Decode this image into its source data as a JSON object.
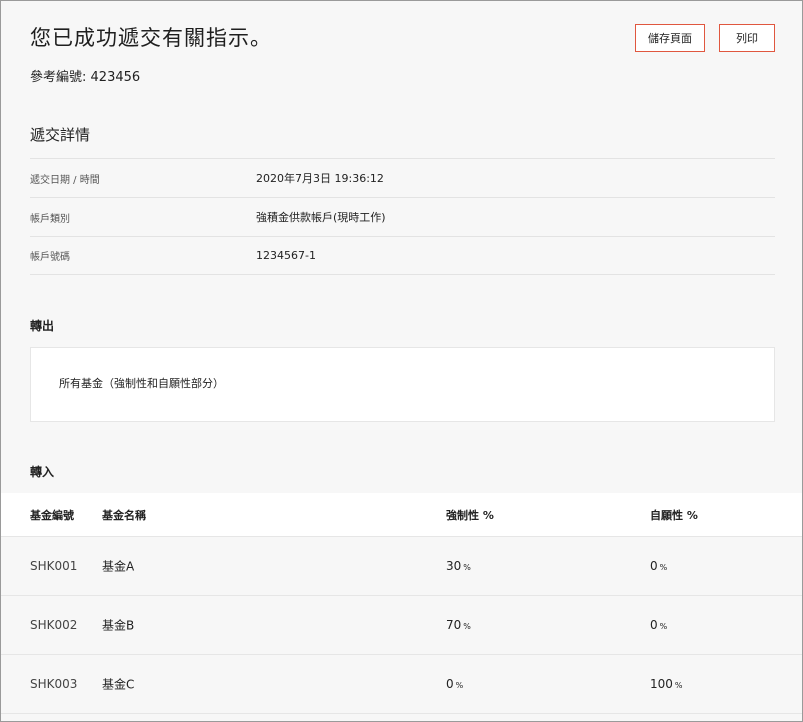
{
  "header": {
    "title": "您已成功遞交有關指示。",
    "reference_label": "參考編號:",
    "reference_number": "423456",
    "save_label": "儲存頁面",
    "print_label": "列印"
  },
  "details": {
    "title": "遞交詳情",
    "rows": [
      {
        "label": "遞交日期 / 時間",
        "value": "2020年7月3日 19:36:12"
      },
      {
        "label": "帳戶類別",
        "value": "強積金供款帳戶(現時工作)"
      },
      {
        "label": "帳戶號碼",
        "value": "1234567-1"
      }
    ]
  },
  "transfer_out": {
    "title": "轉出",
    "content": "所有基金（強制性和自願性部分）"
  },
  "transfer_in": {
    "title": "轉入",
    "columns": [
      "基金編號",
      "基金名稱",
      "強制性 %",
      "自願性 %"
    ],
    "rows": [
      {
        "code": "SHK001",
        "name": "基金A",
        "mandatory": "30",
        "voluntary": "0"
      },
      {
        "code": "SHK002",
        "name": "基金B",
        "mandatory": "70",
        "voluntary": "0"
      },
      {
        "code": "SHK003",
        "name": "基金C",
        "mandatory": "0",
        "voluntary": "100"
      }
    ],
    "percent_unit": "%"
  }
}
